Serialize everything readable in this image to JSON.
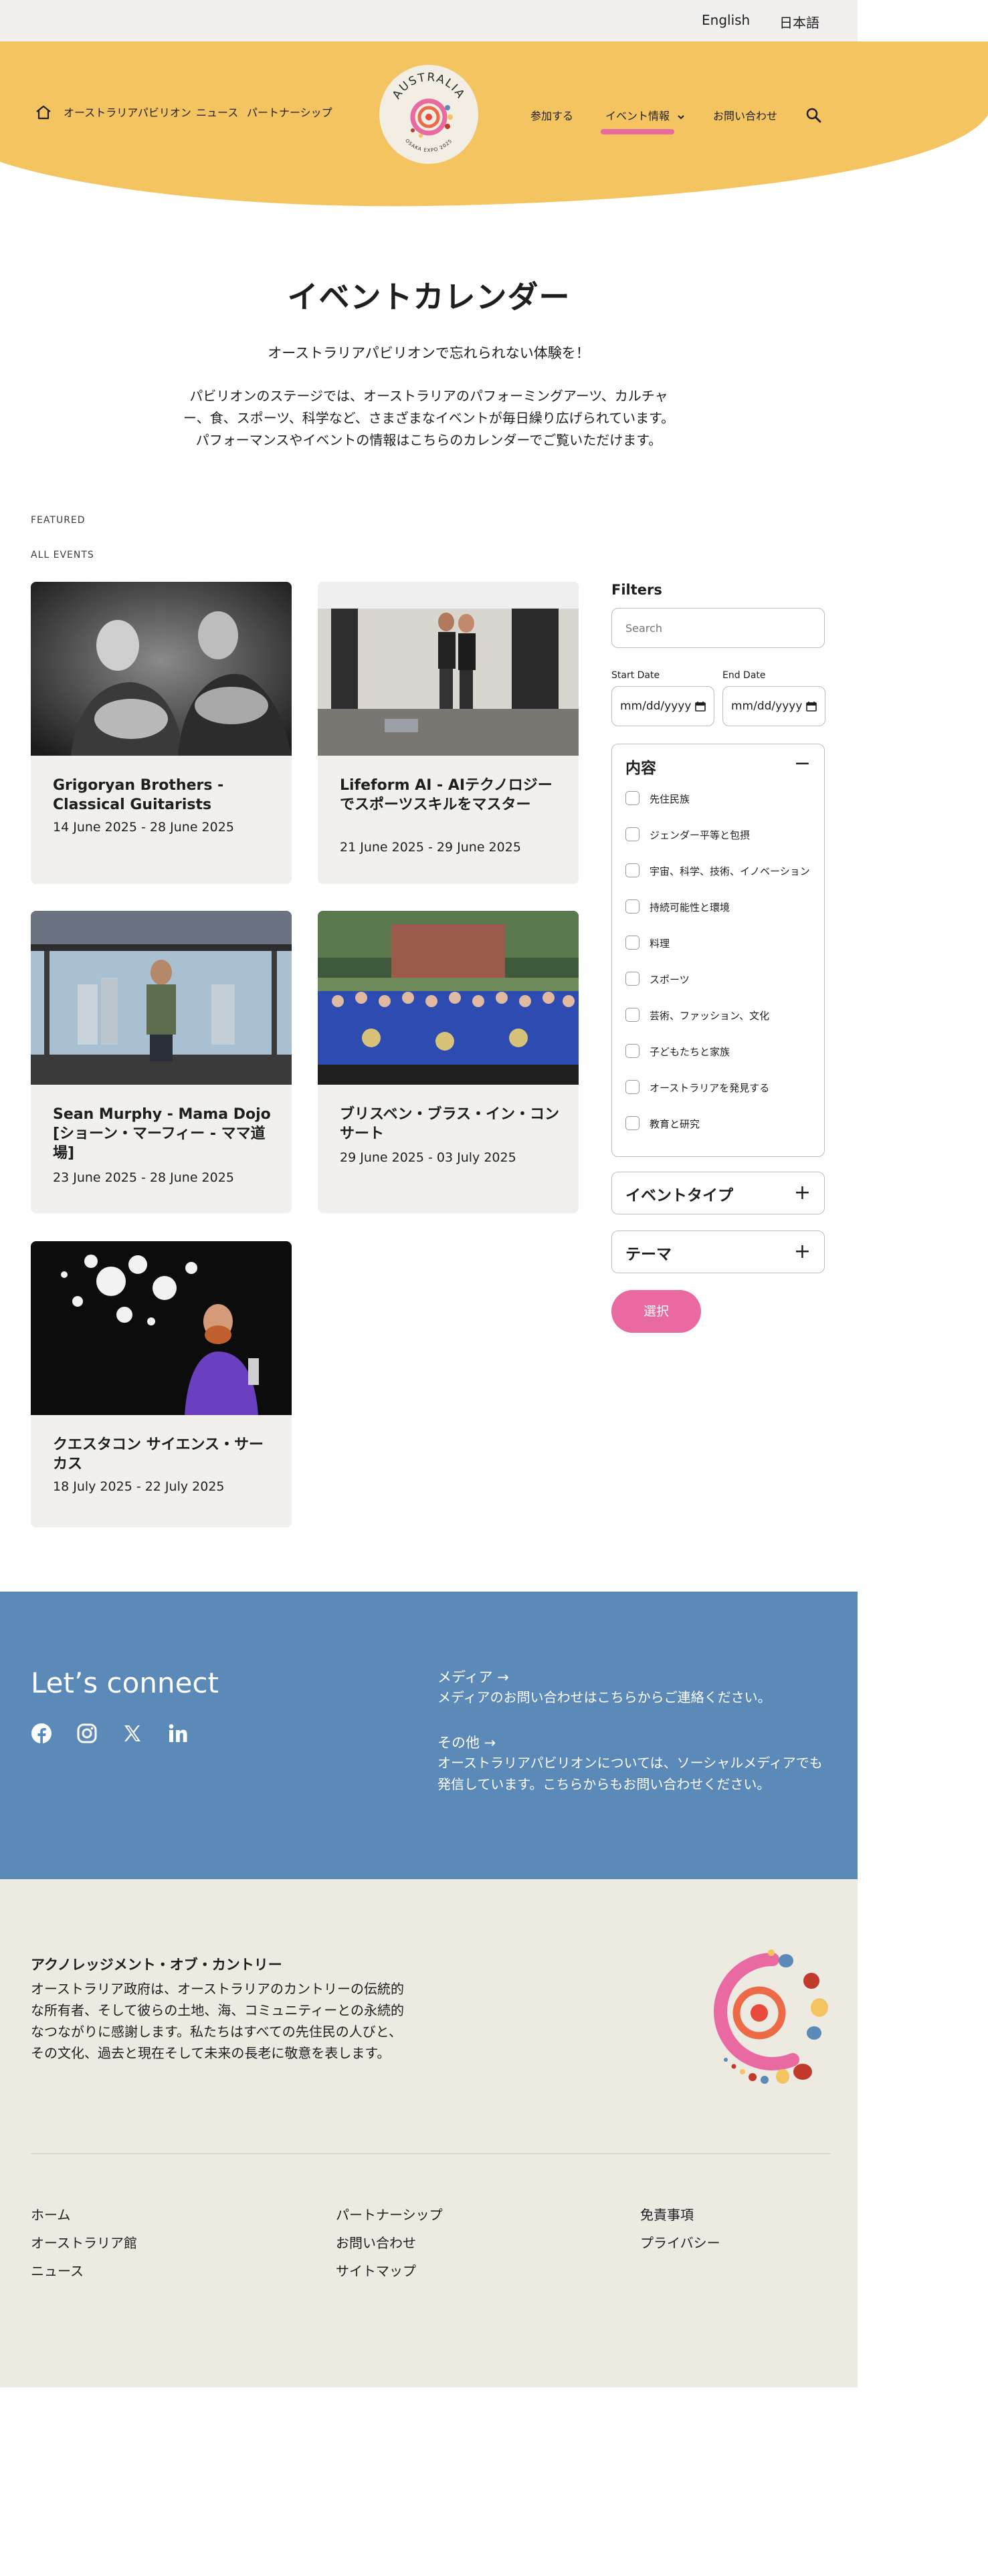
{
  "lang": {
    "english": "English",
    "japanese": "日本語"
  },
  "nav": {
    "pavilion": "オーストラリアパビリオン",
    "news": "ニュース",
    "partnership": "パートナーシップ",
    "join": "参加する",
    "events": "イベント情報",
    "contact": "お問い合わせ"
  },
  "logo": {
    "word": "AUSTRALIA",
    "tag": "OSAKA EXPO 2025"
  },
  "hero": {
    "title": "イベントカレンダー",
    "subtitle": "オーストラリアパビリオンで忘れられない体験を！",
    "intro": "パビリオンのステージでは、オーストラリアのパフォーミングアーツ、カルチャー、食、スポーツ、科学など、さまざまなイベントが毎日繰り広げられています。パフォーマンスやイベントの情報はこちらのカレンダーでご覧いただけます。"
  },
  "labels": {
    "featured": "FEATURED",
    "all_events": "ALL EVENTS"
  },
  "events": [
    {
      "title": "Grigoryan Brothers - Classical Guitarists",
      "dates": "14 June 2025 - 28 June 2025"
    },
    {
      "title": "Lifeform AI - AIテクノロジーでスポーツスキルをマスター",
      "dates": "21 June 2025 - 29 June 2025"
    },
    {
      "title": "Sean Murphy - Mama Dojo [ショーン・マーフィー - ママ道場]",
      "dates": "23 June 2025 - 28 June 2025"
    },
    {
      "title": "ブリスベン・ブラス・イン・コンサート",
      "dates": "29 June 2025 - 03 July 2025"
    },
    {
      "title": "クエスタコン サイエンス・サーカス",
      "dates": "18 July 2025 - 22 July 2025"
    }
  ],
  "filters": {
    "title": "Filters",
    "search_placeholder": "Search",
    "start_label": "Start Date",
    "end_label": "End Date",
    "date_placeholder": "mm/dd/yyyy",
    "content_title": "内容",
    "content_options": [
      "先住民族",
      "ジェンダー平等と包摂",
      "宇宙、科学、技術、イノベーション",
      "持続可能性と環境",
      "料理",
      "スポーツ",
      "芸術、ファッション、文化",
      "子どもたちと家族",
      "オーストラリアを発見する",
      "教育と研究"
    ],
    "event_type_title": "イベントタイプ",
    "theme_title": "テーマ",
    "select_label": "選択"
  },
  "connect": {
    "title": "Let’s connect",
    "media_head": "メディア →",
    "media_text": "メディアのお問い合わせはこちらからご連絡ください。",
    "other_head": "その他 →",
    "other_text": "オーストラリアパビリオンについては、ソーシャルメディアでも発信しています。こちらからもお問い合わせください。"
  },
  "ack": {
    "title": "アクノレッジメント・オブ・カントリー",
    "text": "オーストラリア政府は、オーストラリアのカントリーの伝統的な所有者、そして彼らの土地、海、コミュニティーとの永続的なつながりに感謝します。私たちはすべての先住民の人びと、その文化、過去と現在そして未来の長老に敬意を表します。"
  },
  "footer": {
    "col1": [
      "ホーム",
      "オーストラリア館",
      "ニュース"
    ],
    "col2": [
      "パートナーシップ",
      "お問い合わせ",
      "サイトマップ"
    ],
    "col3": [
      "免責事項",
      "プライバシー"
    ]
  },
  "colors": {
    "header_yellow": "#f4c461",
    "accent_pink": "#e86aa0",
    "connect_blue": "#5b89b8",
    "footer_beige": "#edeae2",
    "card_bg": "#f2f0ec"
  }
}
